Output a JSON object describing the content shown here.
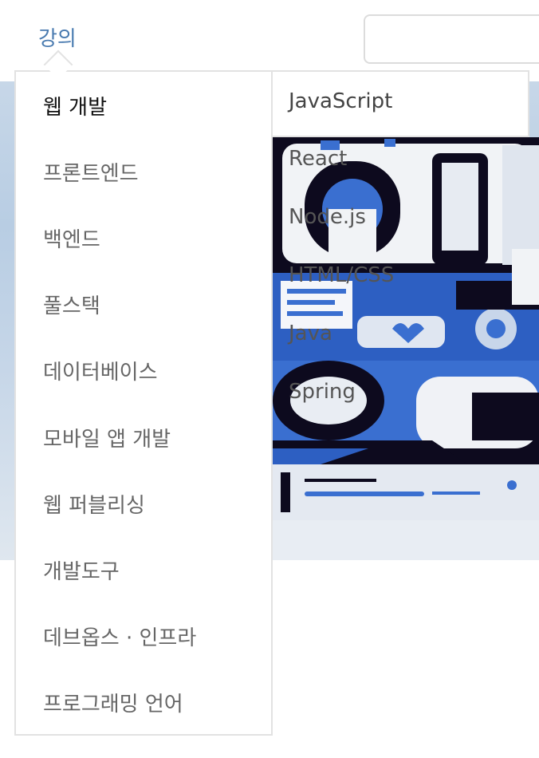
{
  "nav": {
    "lectures_label": "강의",
    "search_value": "",
    "search_placeholder": ""
  },
  "menu": {
    "categories": [
      {
        "label": "웹 개발",
        "active": true
      },
      {
        "label": "프론트엔드",
        "active": false
      },
      {
        "label": "백엔드",
        "active": false
      },
      {
        "label": "풀스택",
        "active": false
      },
      {
        "label": "데이터베이스",
        "active": false
      },
      {
        "label": "모바일 앱 개발",
        "active": false
      },
      {
        "label": "웹 퍼블리싱",
        "active": false
      },
      {
        "label": "개발도구",
        "active": false
      },
      {
        "label": "데브옵스 · 인프라",
        "active": false
      },
      {
        "label": "프로그래밍 언어",
        "active": false
      }
    ],
    "subcategories": [
      {
        "label": "JavaScript"
      },
      {
        "label": "React"
      },
      {
        "label": "Node.js"
      },
      {
        "label": "HTML/CSS"
      },
      {
        "label": "Java"
      },
      {
        "label": "Spring"
      }
    ]
  },
  "colors": {
    "accent": "#4a7bb0",
    "active_text": "#111111",
    "inactive_text": "#666666",
    "border": "#e2e2e2",
    "banner_blue": "#3a6fd0",
    "banner_dark": "#0d0a1e"
  }
}
